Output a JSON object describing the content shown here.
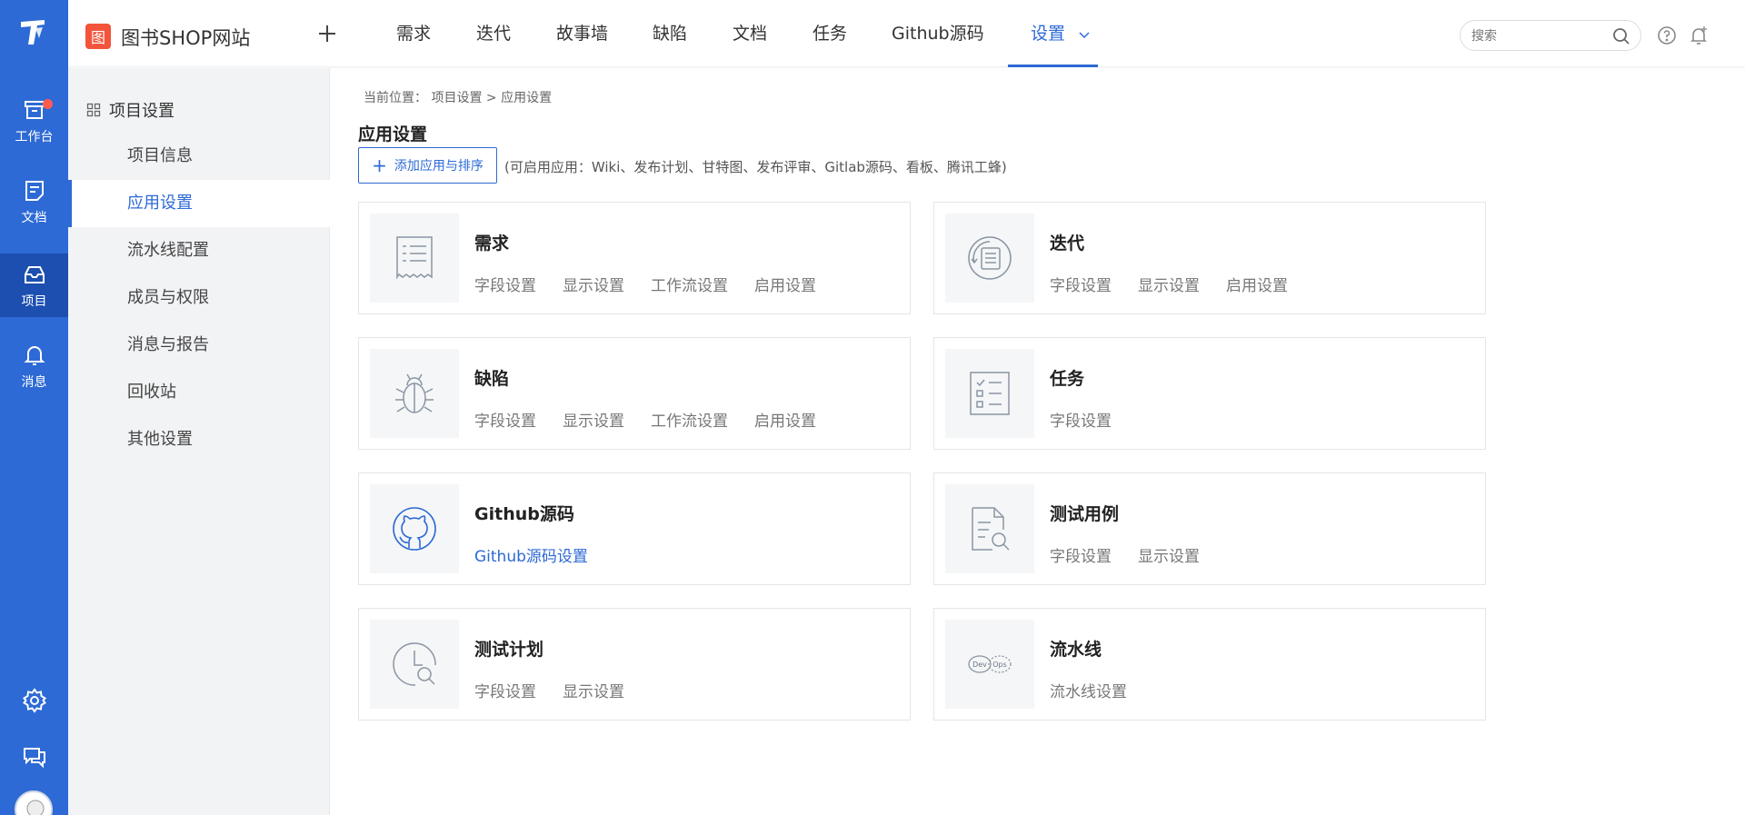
{
  "rail": {
    "items": [
      {
        "label": "工作台",
        "icon": "workbench-icon"
      },
      {
        "label": "文档",
        "icon": "document-icon"
      },
      {
        "label": "项目",
        "icon": "project-icon"
      },
      {
        "label": "消息",
        "icon": "bell-icon"
      }
    ],
    "active_index": 2
  },
  "topbar": {
    "project_badge": "图",
    "project_name": "图书SHOP网站",
    "tabs": [
      "需求",
      "迭代",
      "故事墙",
      "缺陷",
      "文档",
      "任务",
      "Github源码",
      "设置"
    ],
    "active_tab": "设置",
    "search_placeholder": "搜索"
  },
  "subside": {
    "title": "项目设置",
    "items": [
      "项目信息",
      "应用设置",
      "流水线配置",
      "成员与权限",
      "消息与报告",
      "回收站",
      "其他设置"
    ],
    "active_index": 1
  },
  "main": {
    "breadcrumb": "当前位置： 项目设置  >  应用设置",
    "title": "应用设置",
    "add_button": "添加应用与排序",
    "hint": "(可启用应用：Wiki、发布计划、甘特图、发布评审、Gitlab源码、看板、腾讯工蜂)",
    "cards": [
      {
        "title": "需求",
        "icon": "requirement-icon",
        "links": [
          "字段设置",
          "显示设置",
          "工作流设置",
          "启用设置"
        ]
      },
      {
        "title": "迭代",
        "icon": "iteration-icon",
        "links": [
          "字段设置",
          "显示设置",
          "启用设置"
        ]
      },
      {
        "title": "缺陷",
        "icon": "bug-icon",
        "links": [
          "字段设置",
          "显示设置",
          "工作流设置",
          "启用设置"
        ]
      },
      {
        "title": "任务",
        "icon": "task-icon",
        "links": [
          "字段设置"
        ]
      },
      {
        "title": "Github源码",
        "icon": "github-icon",
        "links": [
          "Github源码设置"
        ]
      },
      {
        "title": "测试用例",
        "icon": "test-case-icon",
        "links": [
          "字段设置",
          "显示设置"
        ]
      },
      {
        "title": "测试计划",
        "icon": "test-plan-icon",
        "links": [
          "字段设置",
          "显示设置"
        ]
      },
      {
        "title": "流水线",
        "icon": "devops-icon",
        "links": [
          "流水线设置"
        ],
        "icon_text": [
          "Dev",
          "Ops"
        ]
      }
    ]
  },
  "colors": {
    "primary": "#2d6ad5",
    "rail_active": "#1c4fb0",
    "badge": "#f2553c"
  }
}
